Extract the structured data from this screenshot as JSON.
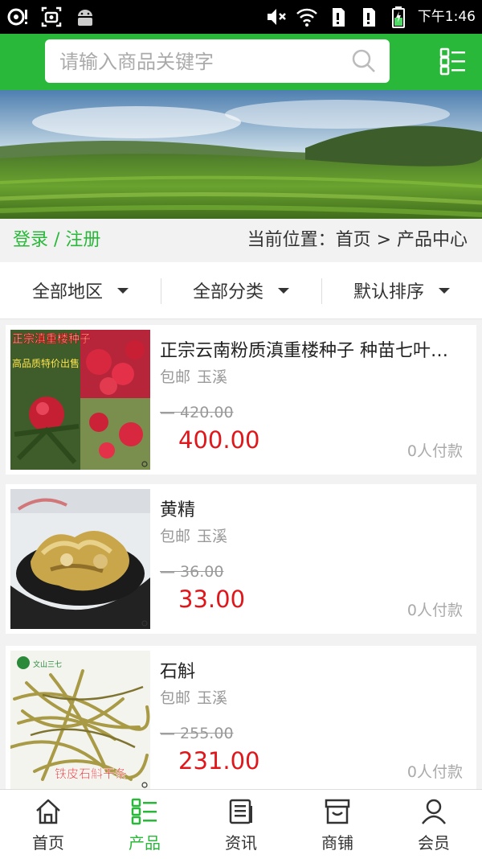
{
  "status_bar": {
    "time": "下午1:46"
  },
  "search": {
    "placeholder": "请输入商品关键字"
  },
  "auth": {
    "login_label": "登录 / 注册"
  },
  "breadcrumb": {
    "text": "当前位置：首页 > 产品中心"
  },
  "filters": [
    {
      "label": "全部地区"
    },
    {
      "label": "全部分类"
    },
    {
      "label": "默认排序"
    }
  ],
  "products": [
    {
      "title": "正宗云南粉质滇重楼种子 种苗七叶一枝花",
      "shipping": "包邮",
      "location": "玉溪",
      "original_price": "420.00",
      "price": "400.00",
      "paid": "0人付款",
      "thumb_text": [
        "正宗滇重楼种子",
        "高品质特价出售"
      ]
    },
    {
      "title": "黄精",
      "shipping": "包邮",
      "location": "玉溪",
      "original_price": "36.00",
      "price": "33.00",
      "paid": "0人付款",
      "thumb_text": []
    },
    {
      "title": "石斛",
      "shipping": "包邮",
      "location": "玉溪",
      "original_price": "255.00",
      "price": "231.00",
      "paid": "0人付款",
      "thumb_text": [
        "铁皮石斛干条"
      ]
    }
  ],
  "bottom_nav": [
    {
      "label": "首页",
      "icon": "home-icon",
      "active": false
    },
    {
      "label": "产品",
      "icon": "grid-list-icon",
      "active": true
    },
    {
      "label": "资讯",
      "icon": "news-icon",
      "active": false
    },
    {
      "label": "商铺",
      "icon": "store-icon",
      "active": false
    },
    {
      "label": "会员",
      "icon": "user-icon",
      "active": false
    }
  ],
  "colors": {
    "brand_green": "#2ab83a",
    "price_red": "#e0161b"
  }
}
